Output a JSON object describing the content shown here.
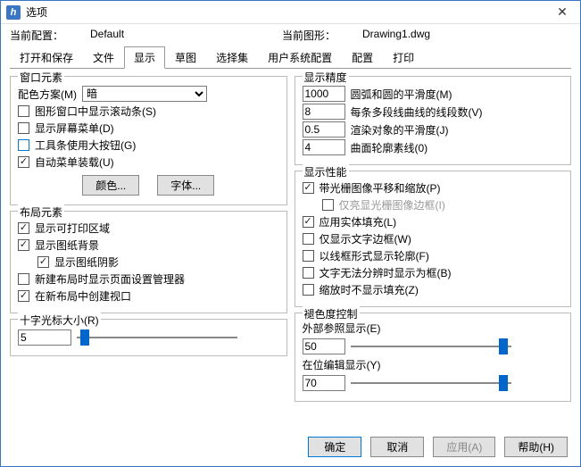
{
  "title": "选项",
  "info": {
    "config_label": "当前配置：",
    "config_value": "Default",
    "drawing_label": "当前图形：",
    "drawing_value": "Drawing1.dwg"
  },
  "tabs": [
    "打开和保存",
    "文件",
    "显示",
    "草图",
    "选择集",
    "用户系统配置",
    "配置",
    "打印"
  ],
  "active_tab": 2,
  "window_elements": {
    "legend": "窗口元素",
    "scheme_label": "配色方案(M)",
    "scheme_value": "暗",
    "show_scroll": "图形窗口中显示滚动条(S)",
    "show_screen_menu": "显示屏幕菜单(D)",
    "big_buttons": "工具条使用大按钮(G)",
    "auto_menu": "自动菜单装载(U)",
    "color_btn": "颜色...",
    "font_btn": "字体..."
  },
  "layout_elements": {
    "legend": "布局元素",
    "printable": "显示可打印区域",
    "paper_bg": "显示图纸背景",
    "paper_shadow": "显示图纸阴影",
    "page_setup_mgr": "新建布局时显示页面设置管理器",
    "create_viewport": "在新布局中创建视口"
  },
  "crosshair": {
    "legend": "十字光标大小(R)",
    "value": "5"
  },
  "precision": {
    "legend": "显示精度",
    "arc_value": "1000",
    "arc_label": "圆弧和圆的平滑度(M)",
    "seg_value": "8",
    "seg_label": "每条多段线曲线的线段数(V)",
    "render_value": "0.5",
    "render_label": "渲染对象的平滑度(J)",
    "contour_value": "4",
    "contour_label": "曲面轮廓素线(0)"
  },
  "performance": {
    "legend": "显示性能",
    "pan_zoom": "带光栅图像平移和缩放(P)",
    "highlight_frame": "仅亮显光栅图像边框(I)",
    "solid_fill": "应用实体填充(L)",
    "text_frame": "仅显示文字边框(W)",
    "wireframe": "以线框形式显示轮廓(F)",
    "replace_box": "文字无法分辨时显示为框(B)",
    "no_fill_on_zoom": "缩放时不显示填充(Z)"
  },
  "fade": {
    "legend": "褪色度控制",
    "xref_label": "外部参照显示(E)",
    "xref_value": "50",
    "inplace_label": "在位编辑显示(Y)",
    "inplace_value": "70"
  },
  "dialog_buttons": {
    "ok": "确定",
    "cancel": "取消",
    "apply": "应用(A)",
    "help": "帮助(H)"
  },
  "icons": {
    "close": "✕",
    "app": "h"
  }
}
